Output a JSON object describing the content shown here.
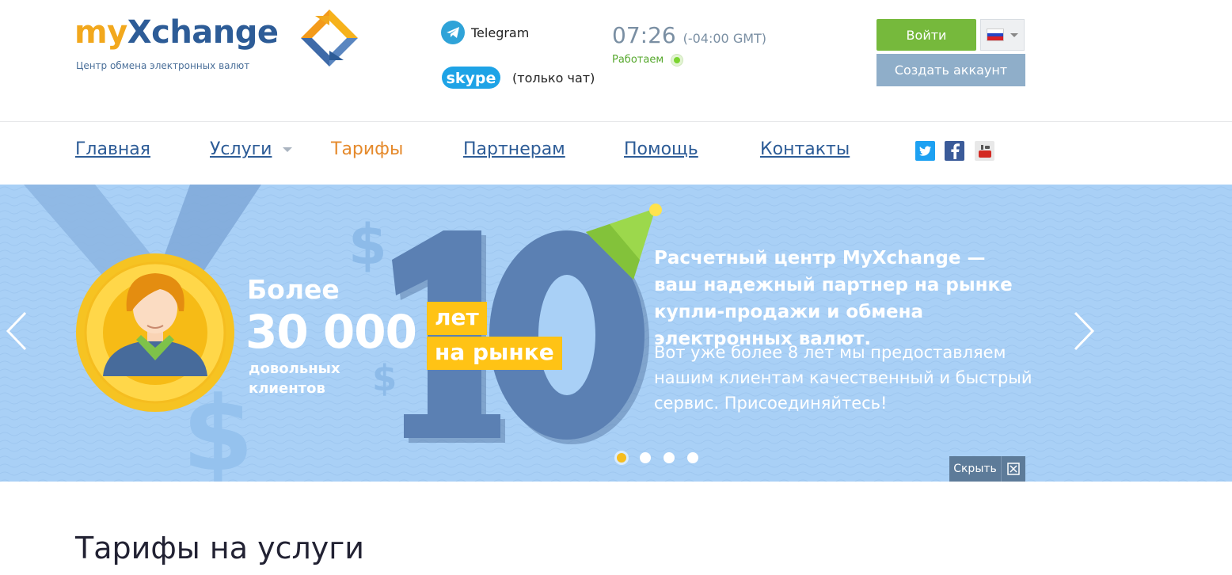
{
  "header": {
    "logo": {
      "part1": "my",
      "part2": "Xchange",
      "subtitle": "Центр обмена электронных валют"
    },
    "telegram_label": "Telegram",
    "skype_label": "skype",
    "skype_note": "(только чат)",
    "time": "07:26",
    "timezone": "(-04:00 GMT)",
    "status": "Работаем",
    "login_label": "Войти",
    "create_account_label": "Создать аккаунт",
    "language": "ru"
  },
  "nav": {
    "items": [
      {
        "label": "Главная"
      },
      {
        "label": "Услуги"
      },
      {
        "label": "Тарифы"
      },
      {
        "label": "Партнерам"
      },
      {
        "label": "Помощь"
      },
      {
        "label": "Контакты"
      }
    ],
    "social": [
      "twitter-icon",
      "facebook-icon",
      "youtube-icon"
    ]
  },
  "banner": {
    "more": "Более",
    "count": "30 000",
    "clients": "довольных клиентов",
    "big_number": "10",
    "tag1": "лет",
    "tag2": "на рынке",
    "headline": "Расчетный центр MyXchange — ваш надежный партнер на рынке купли-продажи и обмена электронных валют.",
    "text": "Вот уже более 8 лет мы предоставляем нашим клиентам качественный и быстрый сервис. Присоединяйтесь!",
    "slides": 4,
    "active_slide": 1,
    "hide_label": "Скрыть"
  },
  "page": {
    "title": "Тарифы на услуги"
  },
  "colors": {
    "brand_orange": "#f2a81d",
    "brand_blue": "#2d5c97",
    "login_green": "#76b93c",
    "banner_bg": "#a9d0f6",
    "tag_yellow": "#ffc315"
  }
}
